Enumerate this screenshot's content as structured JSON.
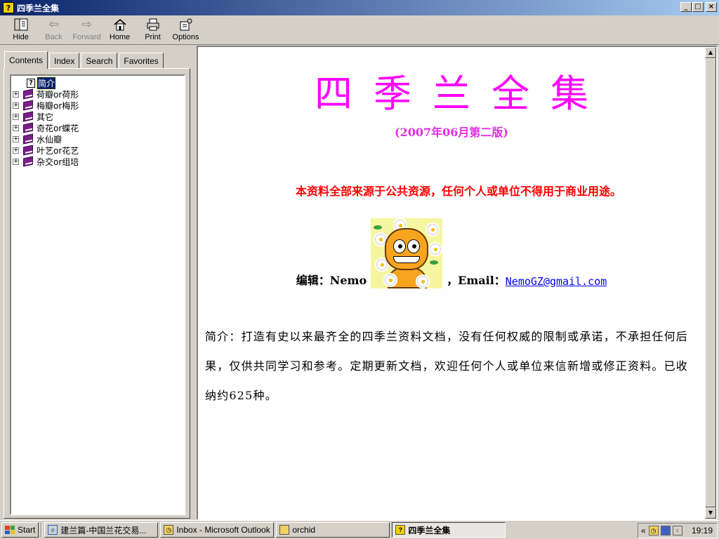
{
  "window": {
    "title": "四季兰全集",
    "controls": [
      "_",
      "□",
      "×"
    ]
  },
  "toolbar": {
    "buttons": [
      {
        "label": "Hide",
        "icon": "hide-icon",
        "enabled": true
      },
      {
        "label": "Back",
        "icon": "back-arrow-icon",
        "enabled": false
      },
      {
        "label": "Forward",
        "icon": "forward-arrow-icon",
        "enabled": false
      },
      {
        "label": "Home",
        "icon": "home-icon",
        "enabled": true
      },
      {
        "label": "Print",
        "icon": "print-icon",
        "enabled": true
      },
      {
        "label": "Options",
        "icon": "options-icon",
        "enabled": true
      }
    ]
  },
  "tabs": [
    {
      "label": "Contents",
      "active": true
    },
    {
      "label": "Index",
      "active": false
    },
    {
      "label": "Search",
      "active": false
    },
    {
      "label": "Favorites",
      "active": false
    }
  ],
  "tree": {
    "selected": "简介",
    "items": [
      "荷瓣or荷形",
      "梅瓣or梅形",
      "其它",
      "奇花or蝶花",
      "水仙瓣",
      "叶艺or花艺",
      "杂交or组培"
    ]
  },
  "document": {
    "title": "四季兰全集",
    "subtitle": "(2007年06月第二版)",
    "warning": "本资料全部来源于公共资源，任何个人或单位不得用于商业用途。",
    "editor_label": "编辑：Nemo",
    "email_label": "，Email：",
    "email": "NemoGZ@gmail.com",
    "intro": "简介：打造有史以来最齐全的四季兰资料文档，没有任何权威的限制或承诺，不承担任何后果，仅供共同学习和参考。定期更新文档，欢迎任何个人或单位来信新增或修正资料。已收纳约625种。"
  },
  "taskbar": {
    "start": "Start",
    "tasks": [
      {
        "label": "建兰篇-中国兰花交易...",
        "active": false
      },
      {
        "label": "Inbox - Microsoft Outlook",
        "active": false
      },
      {
        "label": "orchid",
        "active": false
      },
      {
        "label": "四季兰全集",
        "active": true
      }
    ],
    "tray_chevron": "«",
    "clock": "19:19"
  },
  "colors": {
    "title_magenta": "#ff00ff",
    "warning_red": "#ff0000",
    "link_blue": "#0000ee",
    "titlebar": "#0a246a"
  }
}
